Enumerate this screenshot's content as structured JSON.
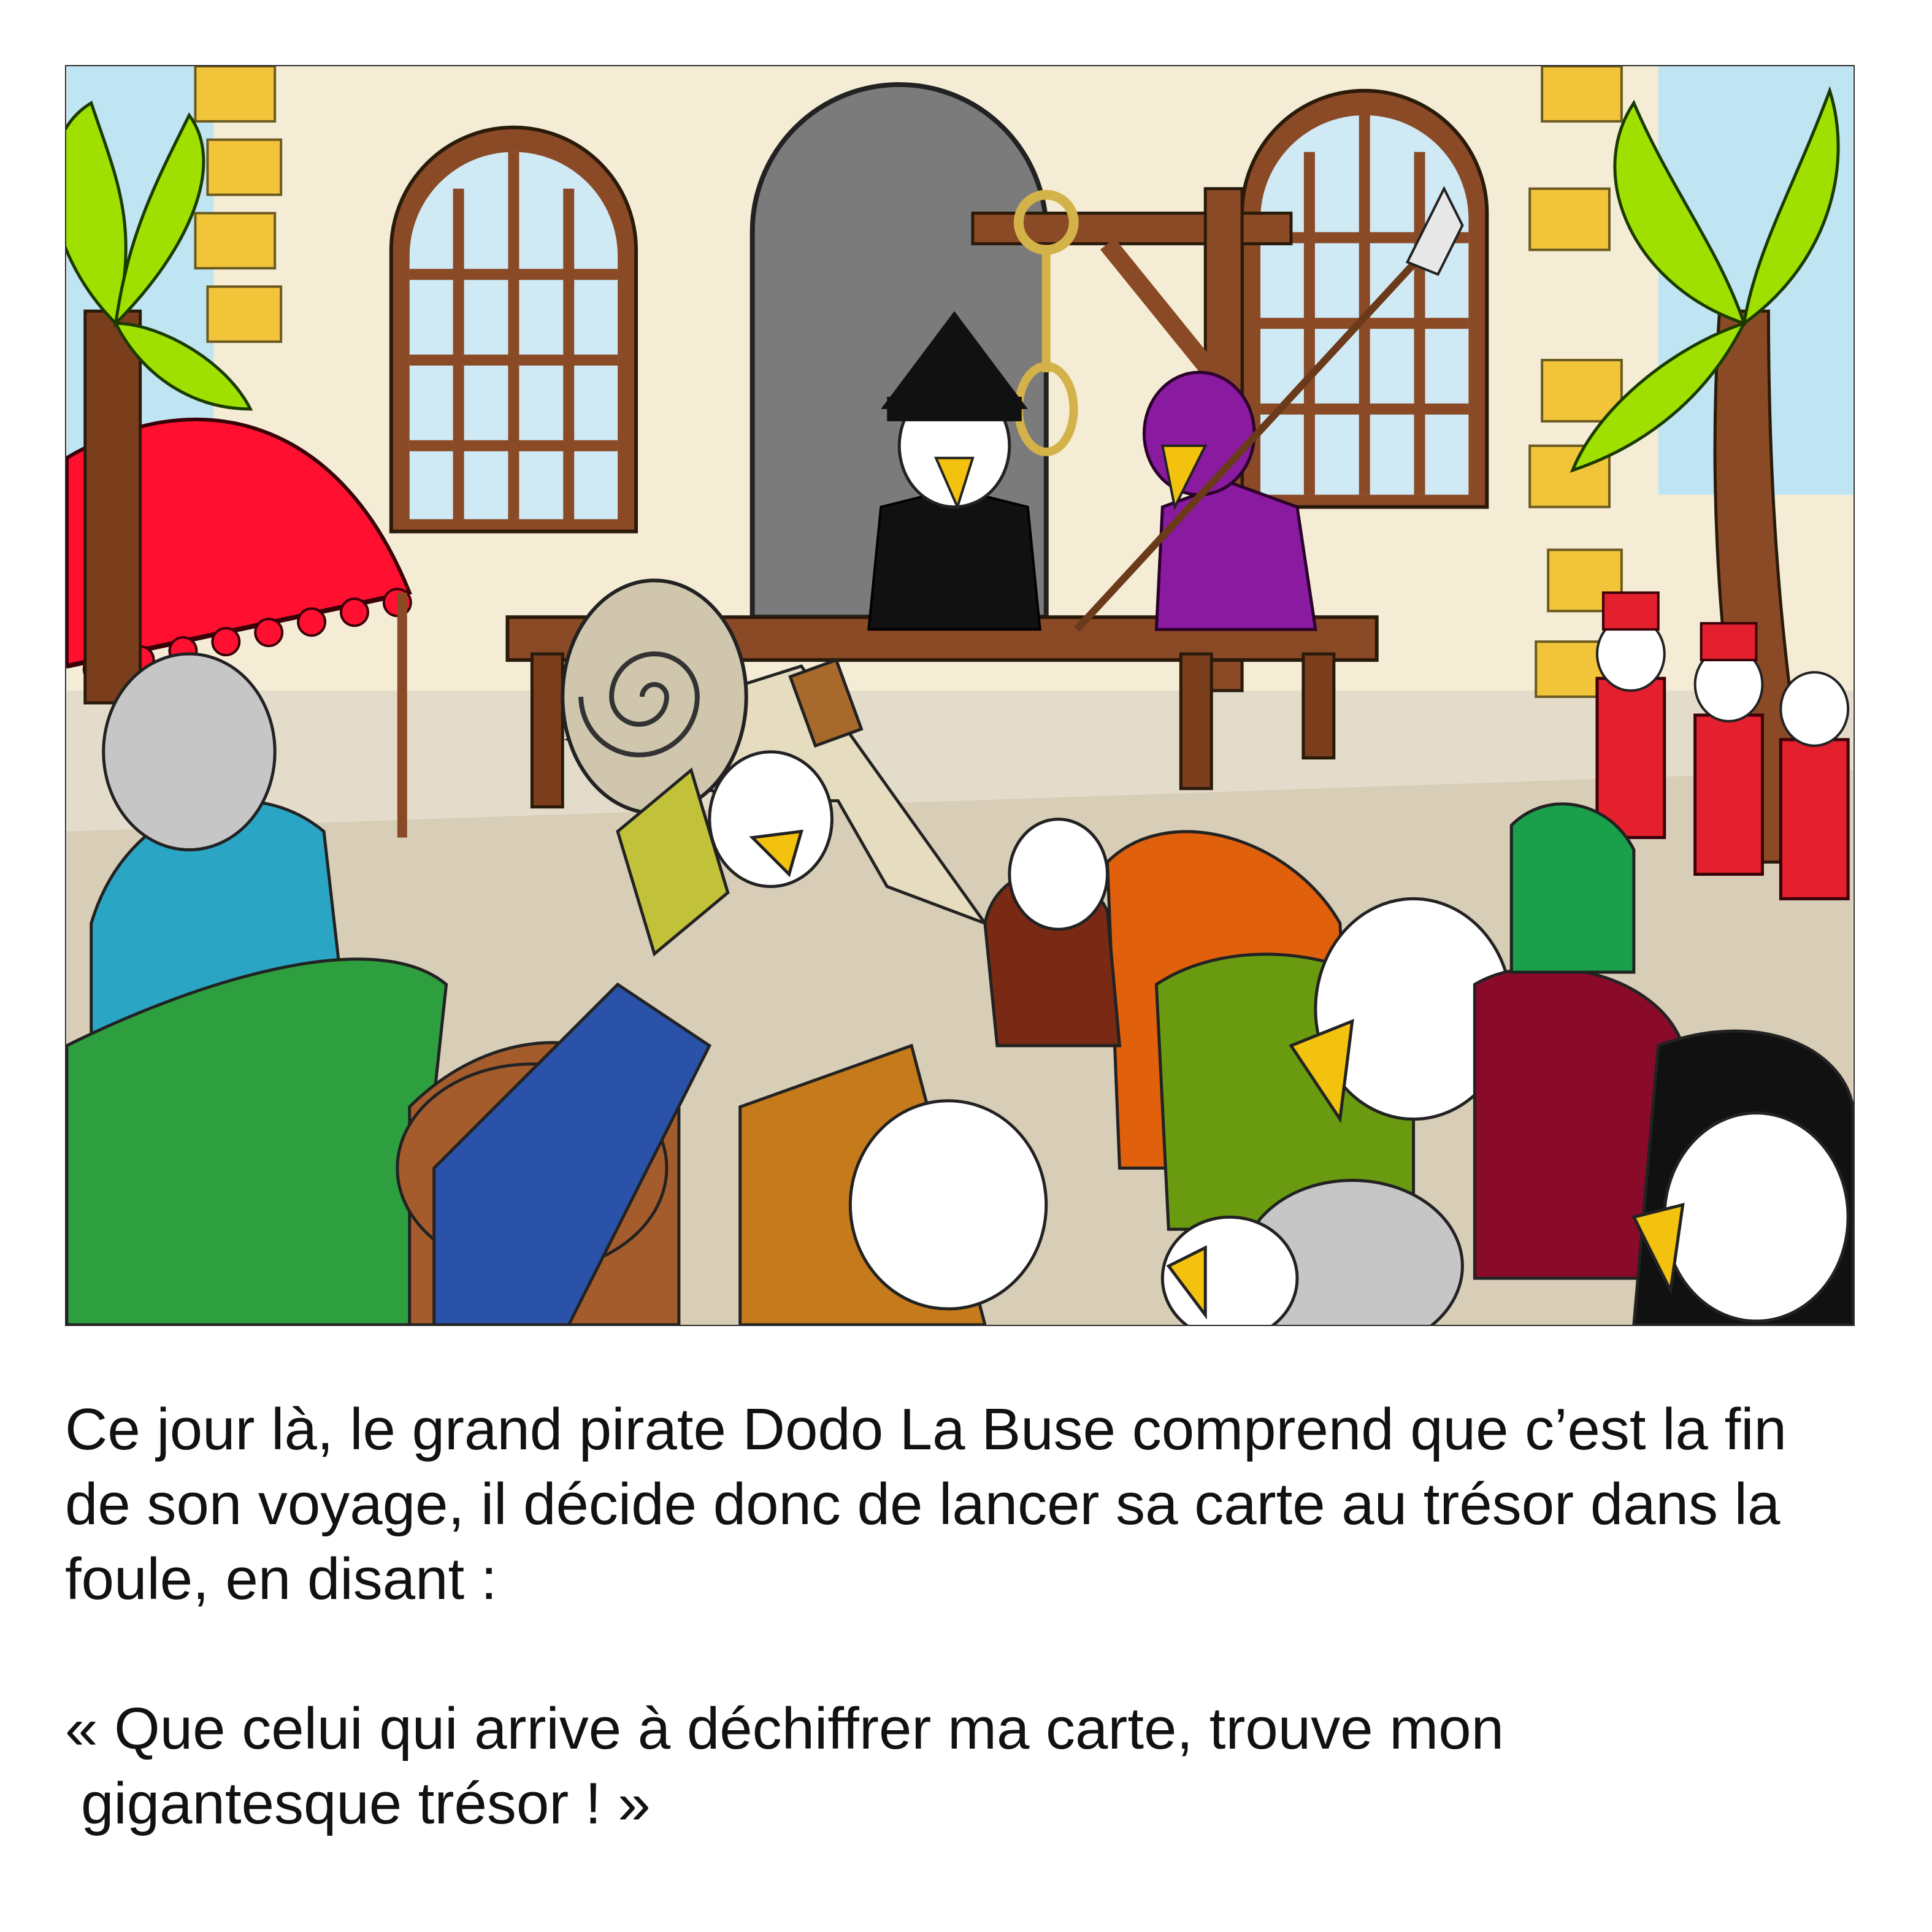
{
  "story_page": {
    "narration": {
      "line1": "Ce jour là, le grand pirate Dodo La Buse comprend que c’est la fin",
      "line2": "de son voyage, il décide donc de lancer sa carte au trésor dans la",
      "line3": "foule, en disant :"
    },
    "quote": {
      "line1": "« Que celui qui arrive à déchiffrer ma carte, trouve mon",
      "line2": "gigantesque trésor ! »"
    }
  },
  "illustration": {
    "scene": "pirate-execution-square",
    "elements": [
      "palm-tree-left",
      "palm-tree-right",
      "arched-window-left",
      "arched-window-right",
      "stone-doorway",
      "gallows-noose",
      "wooden-platform",
      "pirate-bird-black-hat",
      "executioner-bird-purple",
      "halberd",
      "flying-treasure-map-scroll",
      "red-awning",
      "soldier-birds-red-uniform",
      "crowd-of-birds"
    ]
  },
  "colors": {
    "wall": "#f5ecd6",
    "stone_yellow": "#f2c43a",
    "sky": "#bfe4f2",
    "palm_leaf": "#9fe000",
    "wood": "#8a4a26",
    "doorway": "#7b7b7b",
    "awning_red": "#ff1030",
    "executioner_purple": "#8a1aa0",
    "soldier_red": "#e4202e",
    "beak": "#f2c20f",
    "ground": "#e4dccb",
    "text": "#111111"
  }
}
